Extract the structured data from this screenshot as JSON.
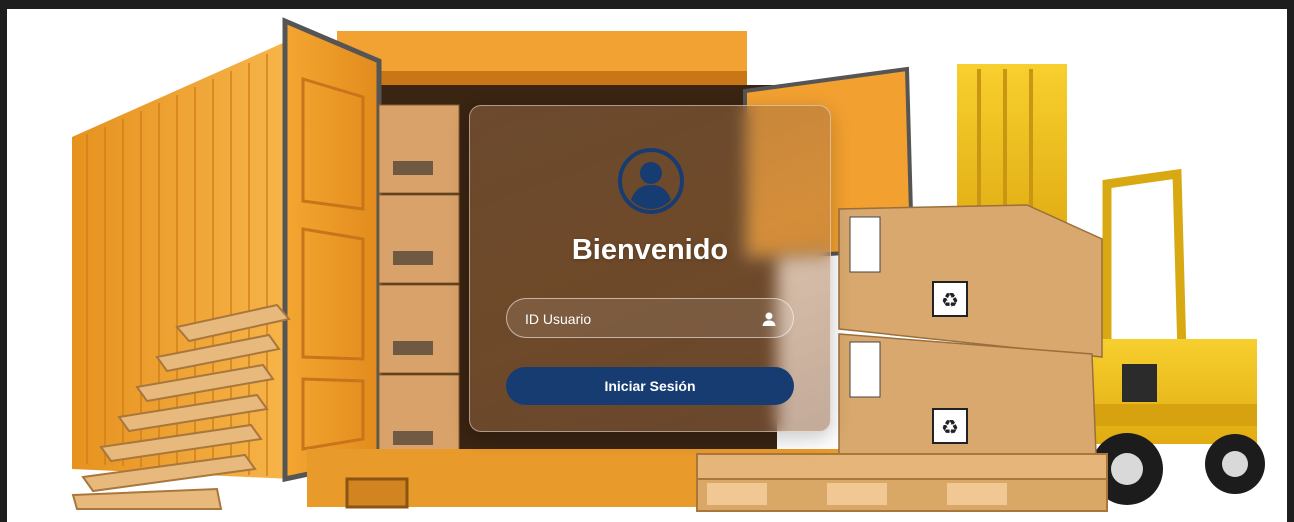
{
  "login": {
    "title": "Bienvenido",
    "user_field": {
      "placeholder": "ID Usuario",
      "value": ""
    },
    "submit_label": "Iniciar Sesión"
  },
  "colors": {
    "button": "#173c72",
    "avatar": "#173c72",
    "container": "#f0a32a",
    "forklift": "#f2c21b",
    "box": "#d8a86e"
  },
  "icons": {
    "avatar": "user-circle-icon",
    "user_field": "user-icon",
    "box_label": "recycle-icon"
  }
}
